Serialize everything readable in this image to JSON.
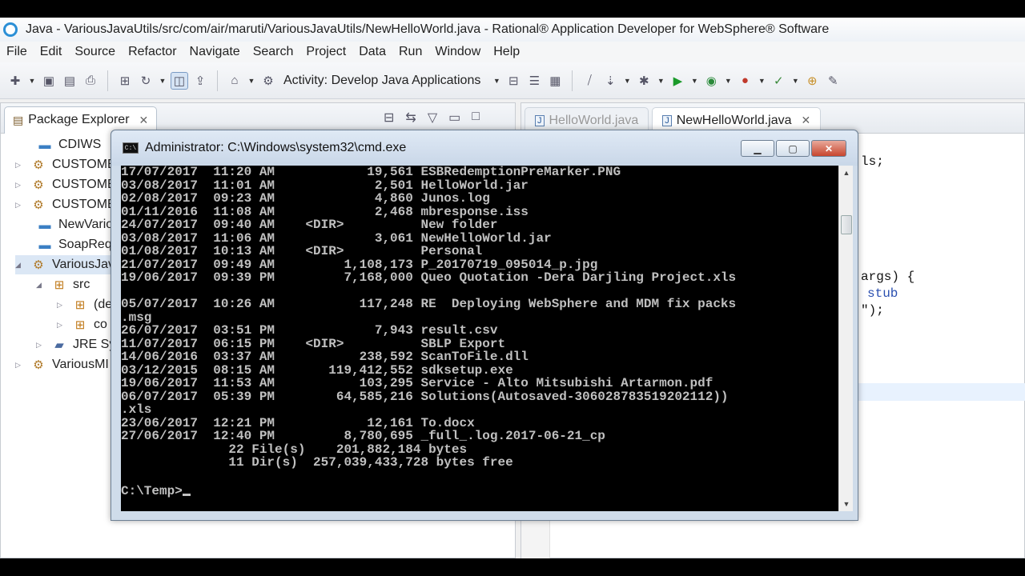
{
  "window": {
    "title": "Java - VariousJavaUtils/src/com/air/maruti/VariousJavaUtils/NewHelloWorld.java - Rational® Application Developer for WebSphere® Software"
  },
  "menu": [
    "File",
    "Edit",
    "Source",
    "Refactor",
    "Navigate",
    "Search",
    "Project",
    "Data",
    "Run",
    "Window",
    "Help"
  ],
  "toolbar": {
    "activity_label": "Activity: Develop Java Applications"
  },
  "package_explorer": {
    "tab_label": "Package Explorer",
    "items": [
      {
        "label": "CDIWS",
        "icon": "folder-icon"
      },
      {
        "label": "CUSTOME",
        "icon": "project-icon"
      },
      {
        "label": "CUSTOME",
        "icon": "project-icon"
      },
      {
        "label": "CUSTOME",
        "icon": "project-icon"
      },
      {
        "label": "NewVario",
        "icon": "folder-icon"
      },
      {
        "label": "SoapRequ",
        "icon": "folder-icon"
      },
      {
        "label": "VariousJav",
        "icon": "project-icon"
      },
      {
        "label": "src",
        "icon": "source-folder-icon"
      },
      {
        "label": "(de",
        "icon": "package-icon"
      },
      {
        "label": "co",
        "icon": "package-icon"
      },
      {
        "label": "JRE Sy",
        "icon": "library-icon"
      },
      {
        "label": "VariousMI",
        "icon": "project-icon"
      }
    ]
  },
  "editor": {
    "tabs": [
      {
        "label": "HelloWorld.java",
        "active": false
      },
      {
        "label": "NewHelloWorld.java",
        "active": true
      }
    ],
    "code_fragments": {
      "line1": "ls;",
      "line2": "args) {",
      "line3": "stub",
      "line4": "\");"
    }
  },
  "cmd": {
    "title": "Administrator: C:\\Windows\\system32\\cmd.exe",
    "icon_text": "C:\\",
    "lines": [
      "17/07/2017  11:20 AM            19,561 ESBRedemptionPreMarker.PNG",
      "03/08/2017  11:01 AM             2,501 HelloWorld.jar",
      "02/08/2017  09:23 AM             4,860 Junos.log",
      "01/11/2016  11:08 AM             2,468 mbresponse.iss",
      "24/07/2017  09:40 AM    <DIR>          New folder",
      "03/08/2017  11:06 AM             3,061 NewHelloWorld.jar",
      "01/08/2017  10:13 AM    <DIR>          Personal",
      "21/07/2017  09:49 AM         1,108,173 P_20170719_095014_p.jpg",
      "19/06/2017  09:39 PM         7,168,000 Queo Quotation -Dera Darjling Project.xls",
      "",
      "05/07/2017  10:26 AM           117,248 RE  Deploying WebSphere and MDM fix packs",
      ".msg",
      "26/07/2017  03:51 PM             7,943 result.csv",
      "11/07/2017  06:15 PM    <DIR>          SBLP Export",
      "14/06/2016  03:37 AM           238,592 ScanToFile.dll",
      "03/12/2015  08:15 AM       119,412,552 sdksetup.exe",
      "19/06/2017  11:53 AM           103,295 Service - Alto Mitsubishi Artarmon.pdf",
      "06/07/2017  05:39 PM        64,585,216 Solutions(Autosaved-306028783519202112))",
      ".xls",
      "23/06/2017  12:21 PM            12,161 To.docx",
      "27/06/2017  12:40 PM         8,780,695 _full_.log.2017-06-21_cp",
      "              22 File(s)    201,882,184 bytes",
      "              11 Dir(s)  257,039,433,728 bytes free"
    ],
    "prompt": "C:\\Temp>"
  }
}
